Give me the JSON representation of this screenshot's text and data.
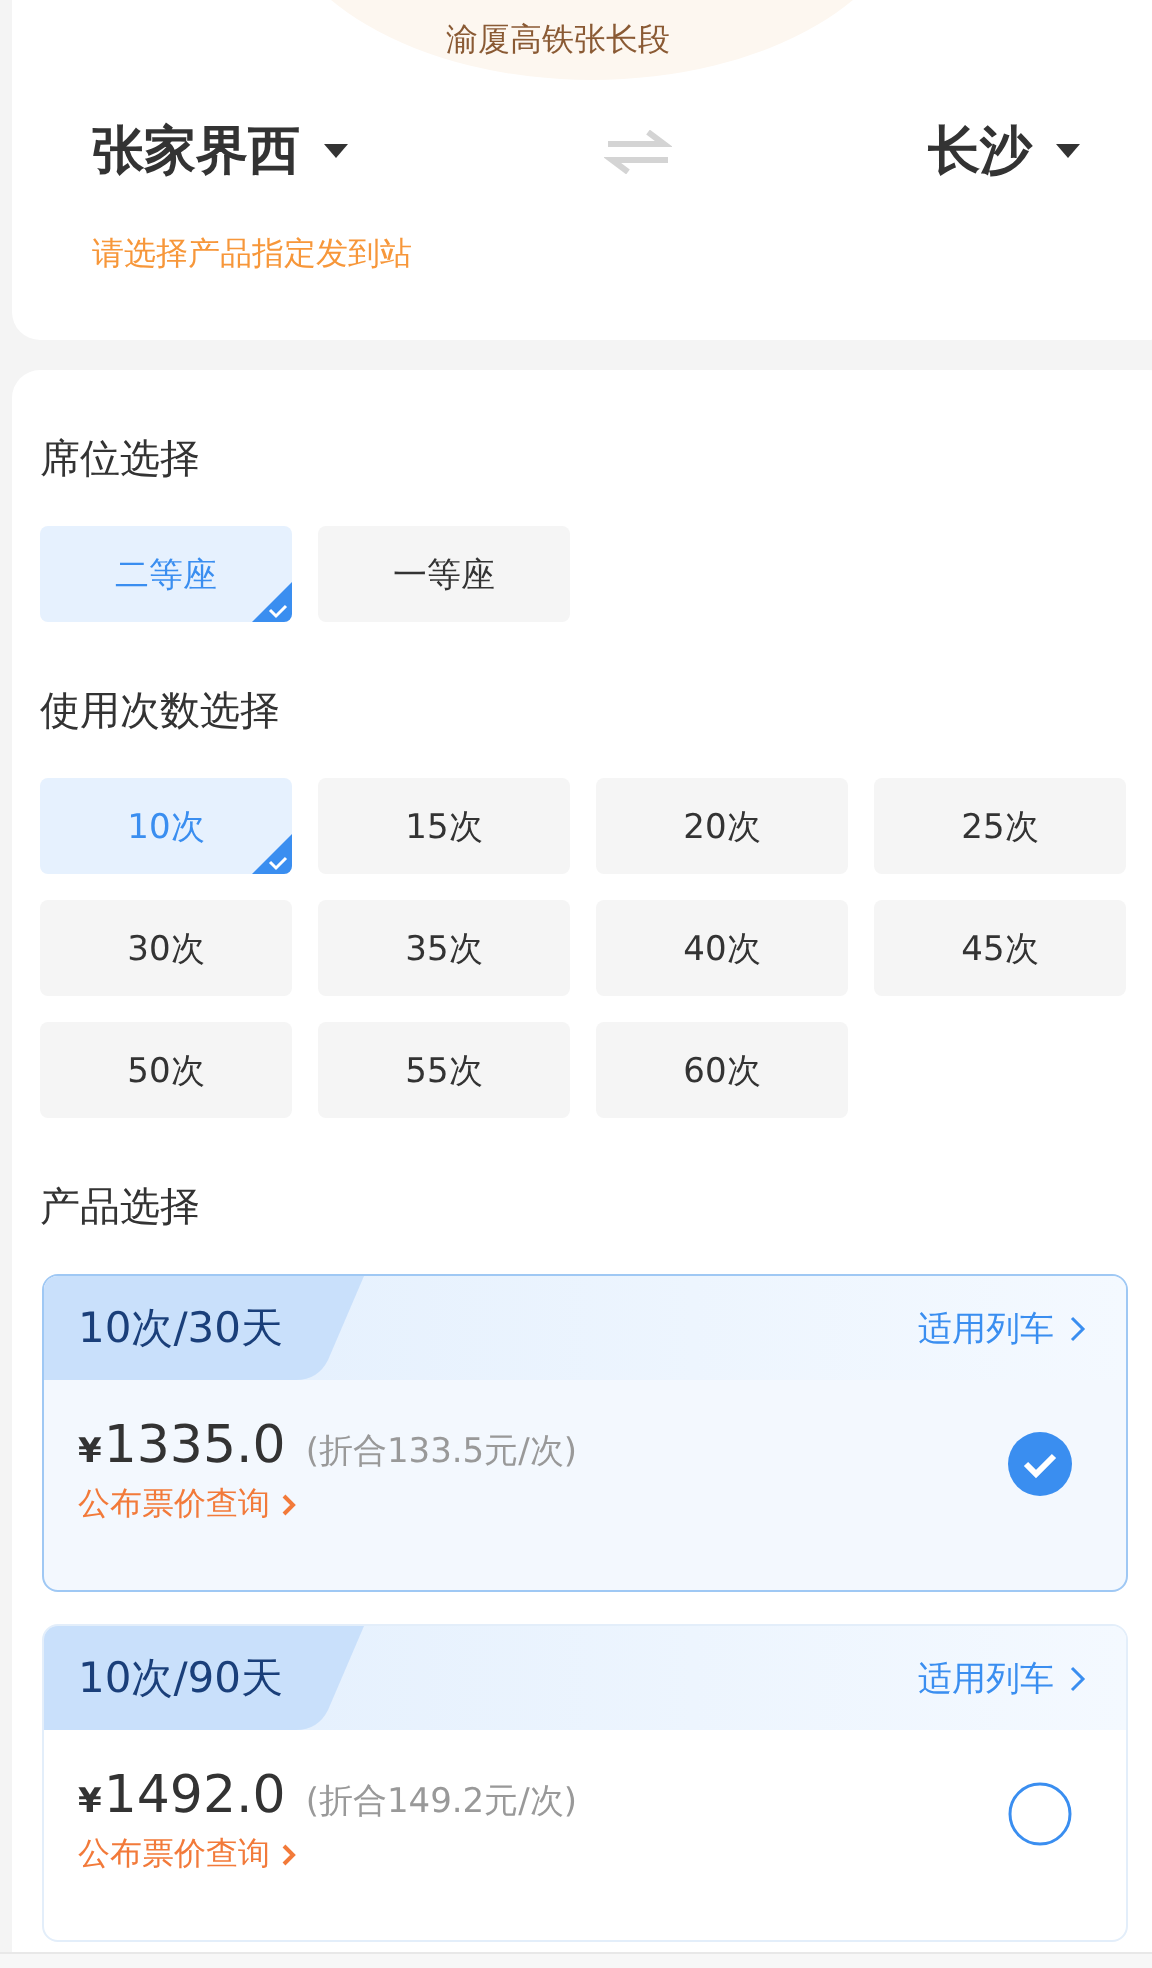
{
  "header": {
    "line": "渝厦高铁张长段",
    "from_station": "张家界西",
    "to_station": "长沙",
    "hint": "请选择产品指定发到站"
  },
  "seat_section": {
    "title": "席位选择",
    "options": [
      {
        "label": "二等座",
        "selected": true
      },
      {
        "label": "一等座",
        "selected": false
      }
    ]
  },
  "count_section": {
    "title": "使用次数选择",
    "options": [
      {
        "label": "10次",
        "selected": true
      },
      {
        "label": "15次",
        "selected": false
      },
      {
        "label": "20次",
        "selected": false
      },
      {
        "label": "25次",
        "selected": false
      },
      {
        "label": "30次",
        "selected": false
      },
      {
        "label": "35次",
        "selected": false
      },
      {
        "label": "40次",
        "selected": false
      },
      {
        "label": "45次",
        "selected": false
      },
      {
        "label": "50次",
        "selected": false
      },
      {
        "label": "55次",
        "selected": false
      },
      {
        "label": "60次",
        "selected": false
      }
    ]
  },
  "product_section": {
    "title": "产品选择",
    "products": [
      {
        "name": "10次/30天",
        "trains_link": "适用列车",
        "currency": "¥",
        "price": "1335.0",
        "unit_price": "(折合133.5元/次)",
        "fare_link": "公布票价查询",
        "selected": true
      },
      {
        "name": "10次/90天",
        "trains_link": "适用列车",
        "currency": "¥",
        "price": "1492.0",
        "unit_price": "(折合149.2元/次)",
        "fare_link": "公布票价查询",
        "selected": false
      }
    ]
  }
}
